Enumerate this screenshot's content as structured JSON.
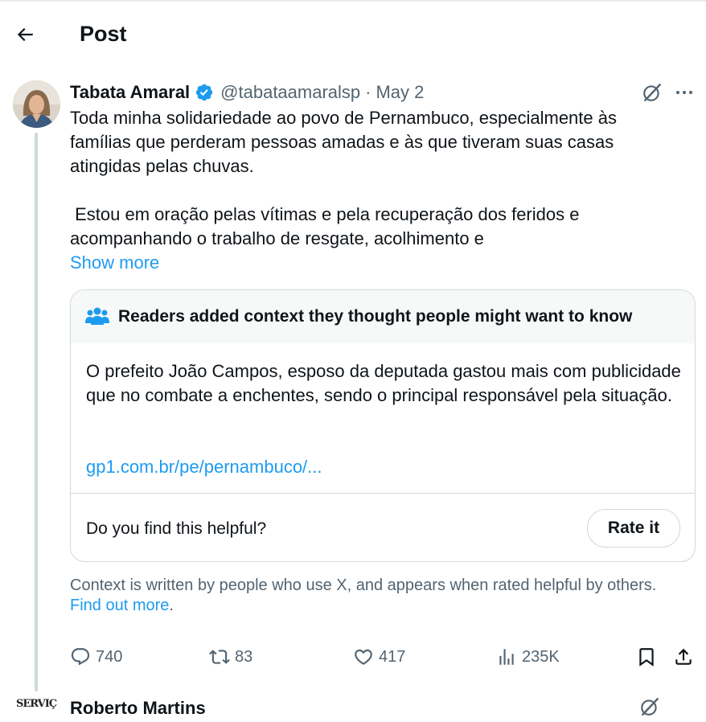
{
  "header": {
    "title": "Post",
    "back_icon": "arrow-left-icon"
  },
  "post": {
    "author_name": "Tabata Amaral",
    "verified_color": "#1d9bf0",
    "handle": "@tabataamaralsp",
    "separator": "·",
    "date": "May 2",
    "body_line1": "Toda minha solidariedade ao povo de Pernambuco, especialmente às famílias que perderam pessoas amadas e às que tiveram suas casas atingidas pelas chuvas.",
    "body_line2": " Estou em oração pelas vítimas e pela recuperação dos feridos e acompanhando o trabalho de resgate, acolhimento e",
    "show_more": "Show more"
  },
  "community_note": {
    "title": "Readers added context they thought people might want to know",
    "text": "O prefeito João Campos, esposo da deputada gastou mais com publicidade que no combate a enchentes, sendo o principal responsável pela situação.",
    "link": "gp1.com.br/pe/pernambuco/...",
    "helpful_question": "Do you find this helpful?",
    "rate_button": "Rate it"
  },
  "disclaimer": {
    "text": "Context is written by people who use X, and appears when rated helpful by others.",
    "link": "Find out more",
    "period": "."
  },
  "actions": {
    "replies": "740",
    "reposts": "83",
    "likes": "417",
    "views": "235K"
  },
  "next_post": {
    "author_name": "Roberto Martins",
    "avatar_text": "SERVIÇ"
  },
  "colors": {
    "link": "#1d9bf0",
    "secondary": "#536471",
    "border": "#cfd9de"
  }
}
